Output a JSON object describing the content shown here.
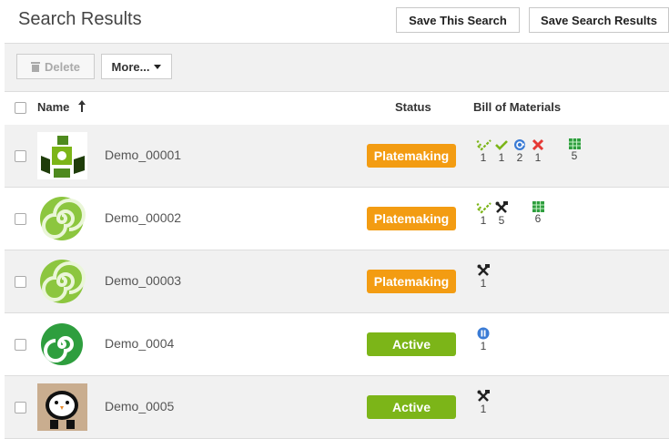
{
  "page": {
    "title": "Search Results"
  },
  "top_actions": {
    "save_search": "Save This Search",
    "save_results": "Save Search Results"
  },
  "toolbar": {
    "delete": "Delete",
    "more": "More..."
  },
  "columns": {
    "name": "Name",
    "status": "Status",
    "bom": "Bill of Materials"
  },
  "status_colors": {
    "Platemaking": "#f39c12",
    "Active": "#7cb518"
  },
  "rows": [
    {
      "name": "Demo_00001",
      "status": "Platemaking",
      "thumb": "green-boxes-thumbnail",
      "bom": [
        {
          "icon": "partial-check-icon",
          "count": "1"
        },
        {
          "icon": "check-icon",
          "count": "1"
        },
        {
          "icon": "refresh-icon",
          "count": "2"
        },
        {
          "icon": "x-icon",
          "count": "1"
        },
        {
          "icon": "table-icon",
          "count": "5"
        }
      ]
    },
    {
      "name": "Demo_00002",
      "status": "Platemaking",
      "thumb": "spiral-thumbnail",
      "bom": [
        {
          "icon": "partial-check-icon",
          "count": "1"
        },
        {
          "icon": "tools-icon",
          "count": "5"
        },
        {
          "icon": "table-icon",
          "count": "6"
        }
      ]
    },
    {
      "name": "Demo_00003",
      "status": "Platemaking",
      "thumb": "spiral-thumbnail",
      "bom": [
        {
          "icon": "tools-icon",
          "count": "1"
        }
      ]
    },
    {
      "name": "Demo_0004",
      "status": "Active",
      "thumb": "green-circle-spiral-thumbnail",
      "bom": [
        {
          "icon": "pause-icon",
          "count": "1"
        }
      ]
    },
    {
      "name": "Demo_0005",
      "status": "Active",
      "thumb": "penguin-thumbnail",
      "bom": [
        {
          "icon": "tools-icon",
          "count": "1"
        }
      ]
    }
  ]
}
